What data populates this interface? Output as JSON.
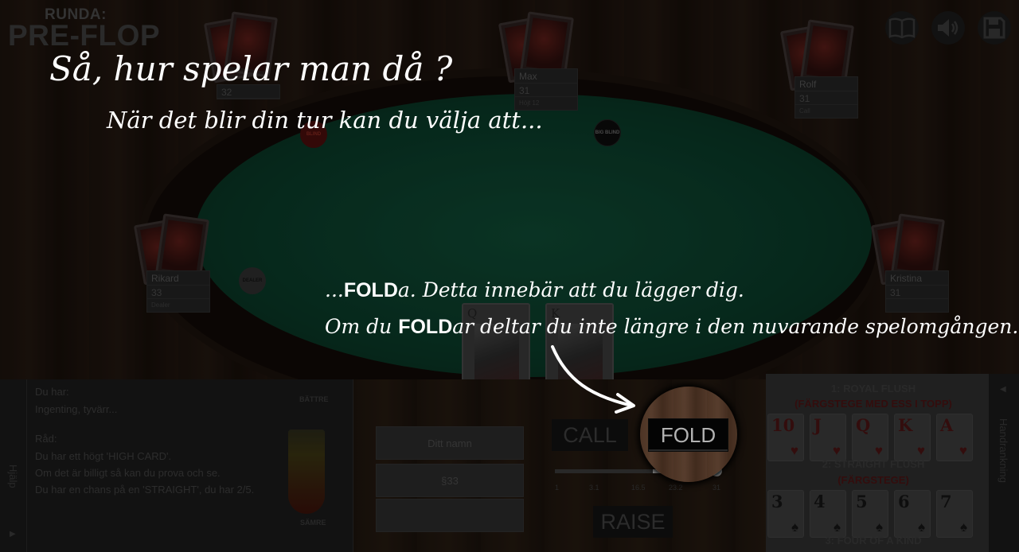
{
  "round": {
    "label": "RUNDA:",
    "value": "PRE-FLOP"
  },
  "toolbar": {
    "icons": [
      "book-icon",
      "speaker-icon",
      "save-icon"
    ]
  },
  "players": {
    "top_left": {
      "name": "",
      "chips": "32",
      "status": ""
    },
    "max": {
      "name": "Max",
      "chips": "31",
      "status": "Höjt 12"
    },
    "rolf": {
      "name": "Rolf",
      "chips": "31",
      "status": "Call"
    },
    "rikard": {
      "name": "Rikard",
      "chips": "33",
      "status": "Dealer"
    },
    "kristina": {
      "name": "Kristina",
      "chips": "31",
      "status": ""
    }
  },
  "chips": {
    "small_blind": "BLIND",
    "big_blind": "BIG BLIND",
    "dealer": "DEALER"
  },
  "hole_cards": [
    {
      "rank": "Q"
    },
    {
      "rank": "K"
    }
  ],
  "advice": {
    "you_have_label": "Du har:",
    "you_have_value": "Ingenting, tyvärr...",
    "advice_label": "Råd:",
    "lines": [
      "Du har ett högt 'HIGH CARD'.",
      "Om det är billigt så kan du prova och se.",
      "Du har en chans på en 'STRAIGHT', du har 2/5."
    ],
    "meter_top": "BÄTTRE",
    "meter_bottom": "SÄMRE"
  },
  "help_tab": "Hjälp",
  "player_fields": {
    "name": "Ditt namn",
    "chips": "§33",
    "extra": ""
  },
  "actions": {
    "call": "CALL",
    "fold": "FOLD",
    "raise": "RAISE"
  },
  "slider": {
    "value": 31,
    "min": 1,
    "max": 31,
    "ticks": [
      "1",
      "3.1",
      "16.5",
      "23.2",
      "31"
    ]
  },
  "hand_ranking": {
    "tab_label": "Handrankning",
    "items": [
      {
        "title": "1: ROYAL FLUSH",
        "subtitle": "(FÄRGSTEGE MED ESS I TOPP)",
        "cards": [
          {
            "rank": "10",
            "suit": "♥"
          },
          {
            "rank": "J",
            "suit": "♥"
          },
          {
            "rank": "Q",
            "suit": "♥"
          },
          {
            "rank": "K",
            "suit": "♥"
          },
          {
            "rank": "A",
            "suit": "♥"
          }
        ]
      },
      {
        "title": "2: STRAIGHT FLUSH",
        "subtitle": "(FÄRGSTEGE)",
        "cards": [
          {
            "rank": "3",
            "suit": "♠"
          },
          {
            "rank": "4",
            "suit": "♠"
          },
          {
            "rank": "5",
            "suit": "♠"
          },
          {
            "rank": "6",
            "suit": "♠"
          },
          {
            "rank": "7",
            "suit": "♠"
          }
        ]
      },
      {
        "title": "3: FOUR OF A KIND",
        "subtitle": "",
        "cards": []
      }
    ]
  },
  "tutorial": {
    "heading": "Så, hur spelar man då ?",
    "subheading": "När det blir din tur kan du välja att...",
    "line1_prefix": "...",
    "line1_keyword": "FOLD",
    "line1_rest": "a. Detta innebär att du lägger dig.",
    "line2_prefix": "Om du ",
    "line2_keyword": "FOLD",
    "line2_rest": "ar deltar du inte längre i den nuvarande spelomgången."
  }
}
